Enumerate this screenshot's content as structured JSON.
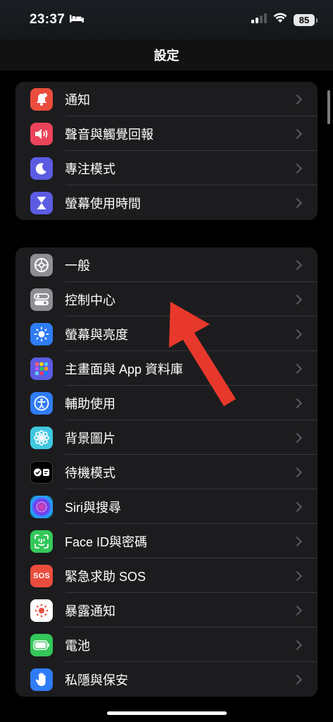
{
  "status_bar": {
    "time": "23:37",
    "focus_icon": "bed-icon",
    "signal_icon": "cellular-signal-icon",
    "wifi_icon": "wifi-icon",
    "battery_level": "85"
  },
  "nav": {
    "title": "設定"
  },
  "group1": [
    {
      "label": "通知",
      "icon": "bell-icon",
      "color": "#eb4d3d"
    },
    {
      "label": "聲音與觸覺回報",
      "icon": "speaker-icon",
      "color": "#eb445a"
    },
    {
      "label": "專注模式",
      "icon": "moon-icon",
      "color": "#5b5ce2"
    },
    {
      "label": "螢幕使用時間",
      "icon": "hourglass-icon",
      "color": "#5b5ce2"
    }
  ],
  "group2": [
    {
      "label": "一般",
      "icon": "gear-icon",
      "color": "#8e8e93"
    },
    {
      "label": "控制中心",
      "icon": "toggles-icon",
      "color": "#8e8e93"
    },
    {
      "label": "螢幕與亮度",
      "icon": "brightness-icon",
      "color": "#2f7cf6"
    },
    {
      "label": "主畫面與 App 資料庫",
      "icon": "app-grid-icon",
      "color": "#5b5ce2"
    },
    {
      "label": "輔助使用",
      "icon": "accessibility-icon",
      "color": "#2f7cf6"
    },
    {
      "label": "背景圖片",
      "icon": "flower-icon",
      "color": "#40c8e0"
    },
    {
      "label": "待機模式",
      "icon": "standby-icon",
      "color": "#000000"
    },
    {
      "label": "Siri與搜尋",
      "icon": "siri-icon",
      "color": "#1a1a1a"
    },
    {
      "label": "Face ID與密碼",
      "icon": "face-id-icon",
      "color": "#34c759"
    },
    {
      "label": "緊急求助 SOS",
      "icon": "sos-icon",
      "color": "#eb4d3d",
      "icon_text": "SOS"
    },
    {
      "label": "暴露通知",
      "icon": "exposure-icon",
      "color": "#ffffff"
    },
    {
      "label": "電池",
      "icon": "battery-icon",
      "color": "#34c759"
    },
    {
      "label": "私隱與保安",
      "icon": "hand-icon",
      "color": "#2f7cf6"
    }
  ],
  "annotation": {
    "arrow_color": "#e8382b",
    "points_to": "控制中心"
  }
}
